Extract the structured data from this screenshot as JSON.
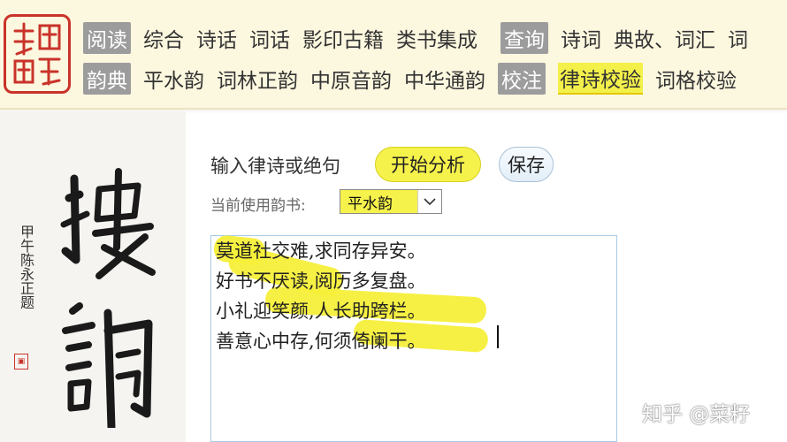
{
  "nav": {
    "row1": {
      "category1": "阅读",
      "items1": [
        "综合",
        "诗话",
        "词话",
        "影印古籍",
        "类书集成"
      ],
      "category2": "查询",
      "items2": [
        "诗词",
        "典故、词汇",
        "词"
      ]
    },
    "row2": {
      "category1": "韵典",
      "items1": [
        "平水韵",
        "词林正韵",
        "中原音韵",
        "中华通韵"
      ],
      "category2": "校注",
      "items2": [
        "律诗校验",
        "词格校验"
      ],
      "active": "律诗校验"
    }
  },
  "calligraphy": {
    "small_text": "甲午陈永正题"
  },
  "form": {
    "prompt": "输入律诗或绝句",
    "start_label": "开始分析",
    "save_label": "保存",
    "rhyme_label": "当前使用韵书:",
    "rhyme_selected": "平水韵",
    "poem_lines": [
      "莫道社交难,求同存异安。",
      "好书不厌读,阅历多复盘。",
      "小礼迎笑颜,人长助跨栏。",
      "善意心中存,何须倚阑干。"
    ]
  },
  "watermark": "知乎 @菜籽",
  "colors": {
    "highlight": "#f5ef3a",
    "seal_red": "#c9332a",
    "nav_bg": "#fcf7df",
    "category_gray": "#9c9c9c"
  }
}
